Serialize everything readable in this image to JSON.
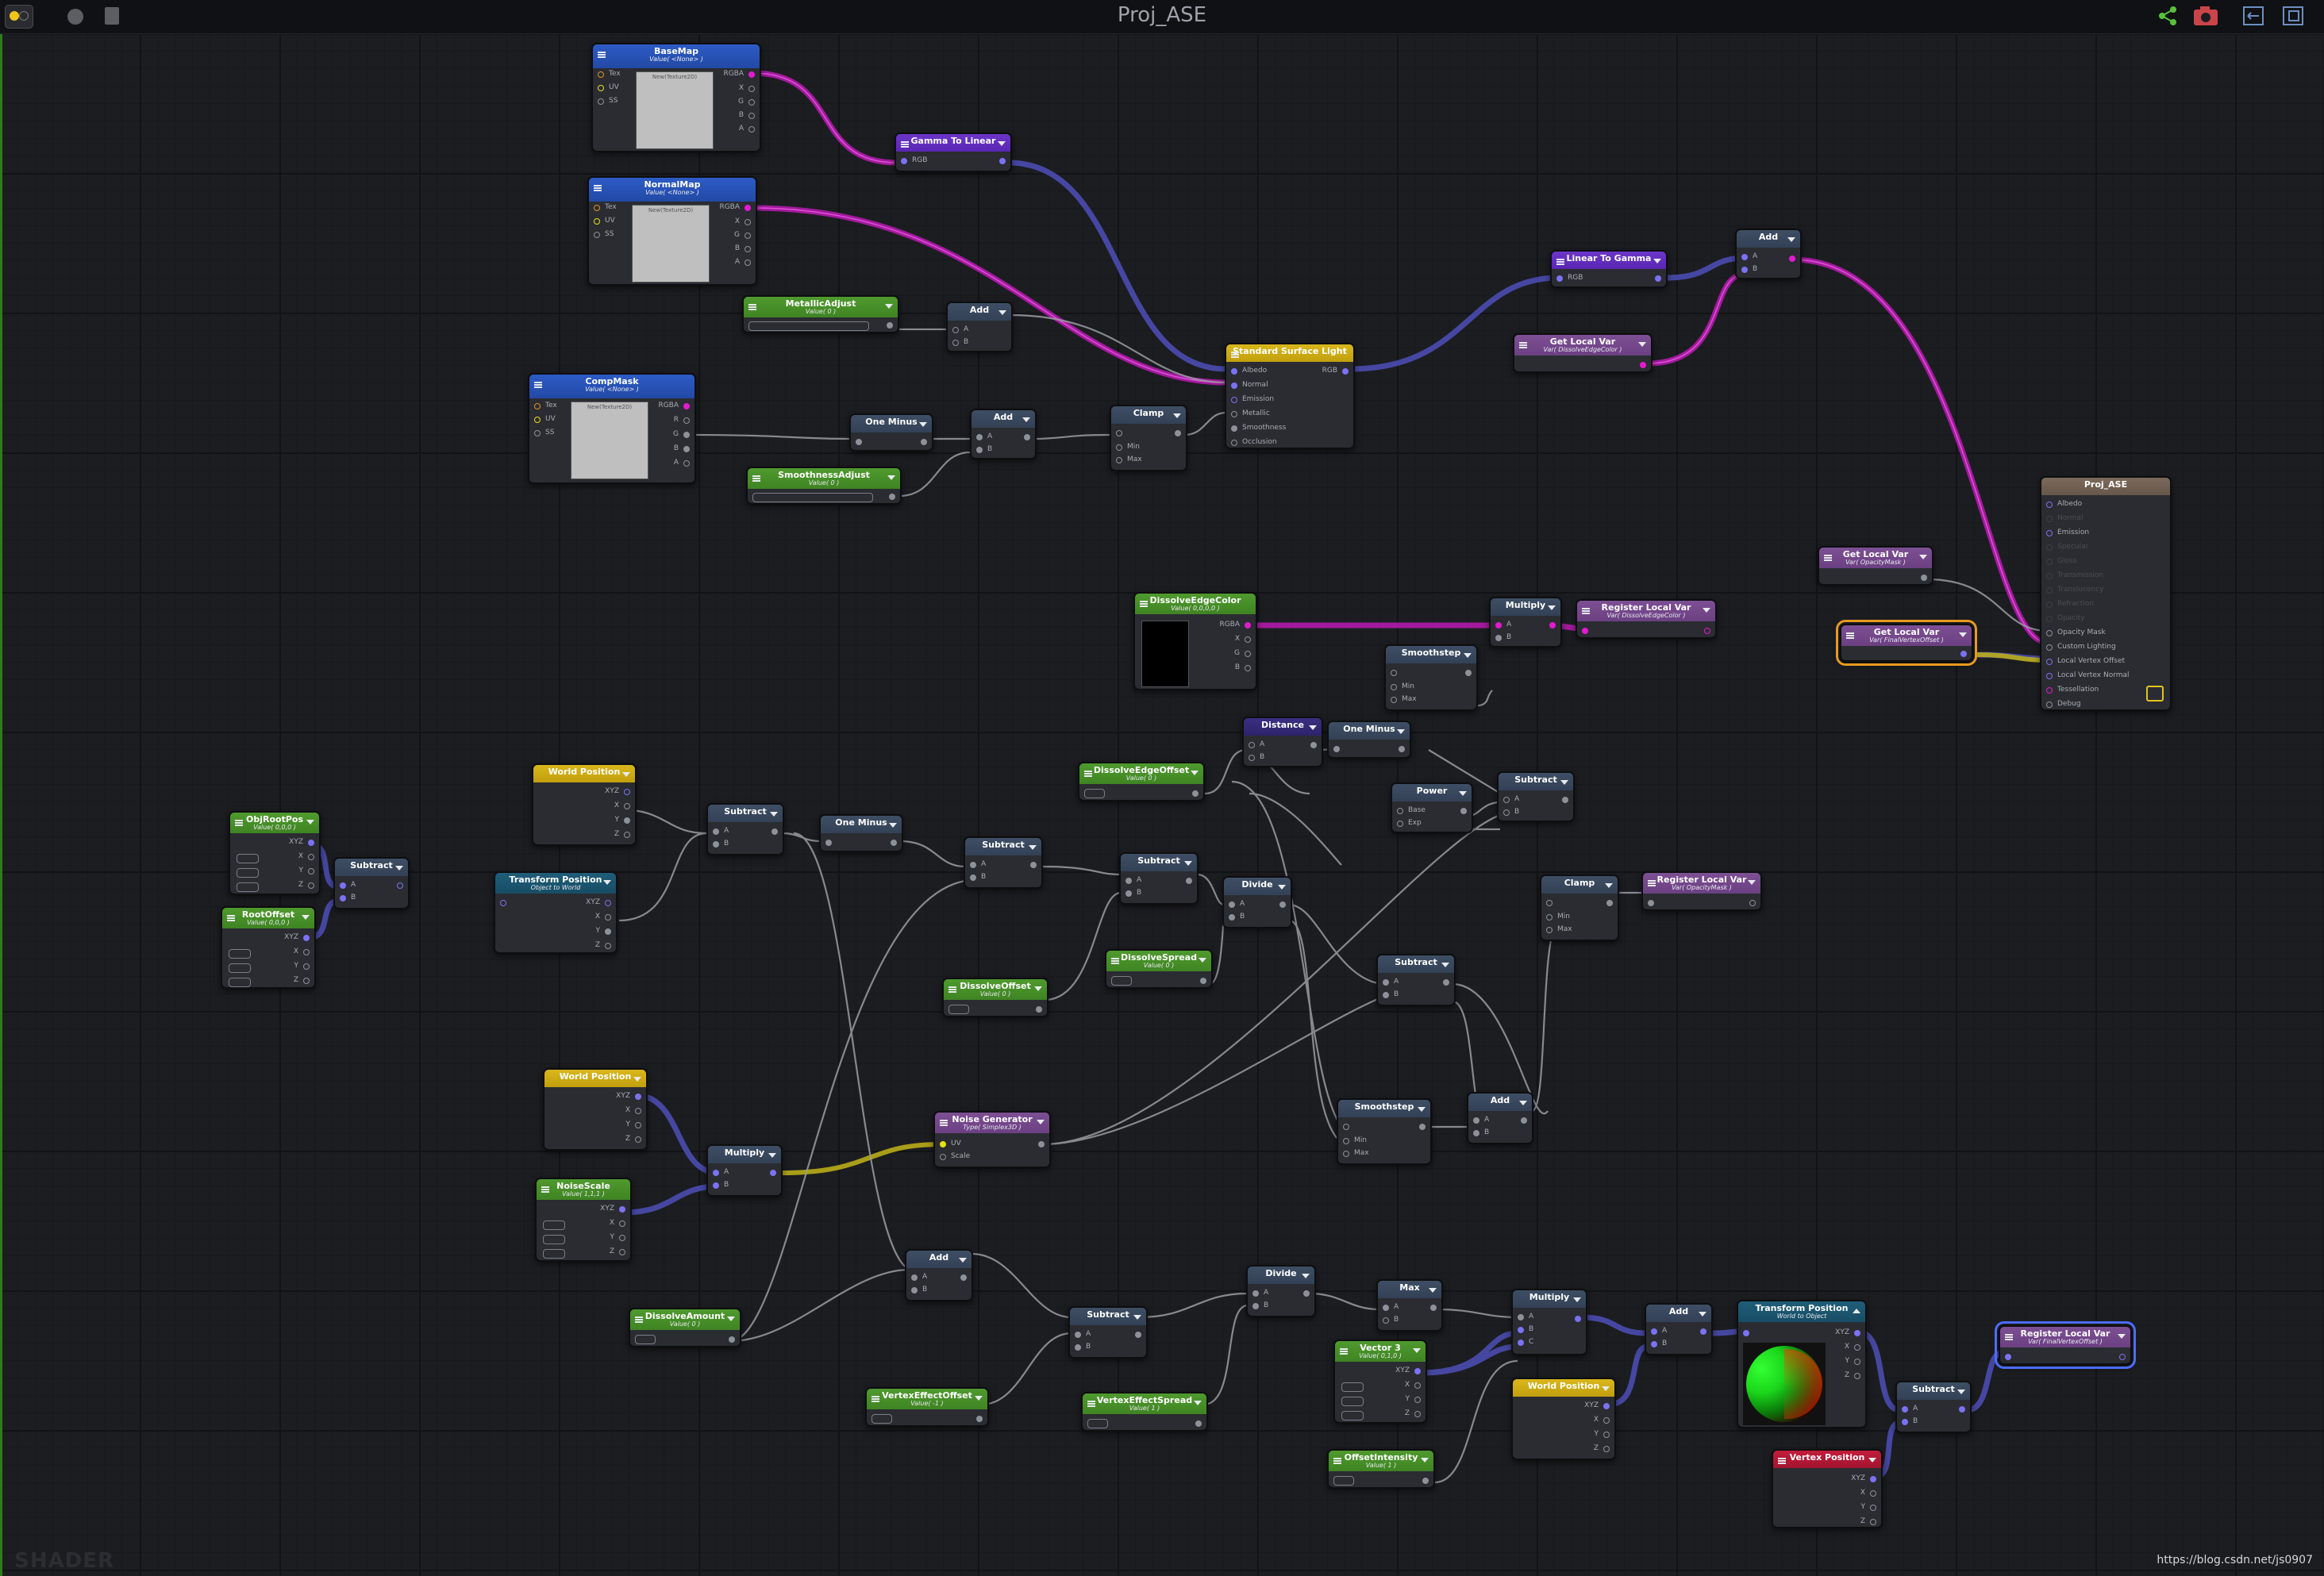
{
  "window": {
    "title": "Proj_ASE"
  },
  "footer": {
    "logo": "SHADER",
    "url": "https://blog.csdn.net/js0907"
  },
  "nodes": {
    "basemap": {
      "title": "BaseMap",
      "sub": "Value( <None> )",
      "preview": "New(Texture2D)"
    },
    "normalmap": {
      "title": "NormalMap",
      "sub": "Value( <None> )",
      "preview": "New(Texture2D)"
    },
    "compmask": {
      "title": "CompMask",
      "sub": "Value( <None> )",
      "preview": "New(Texture2D)"
    },
    "gamma_to_linear": {
      "title": "Gamma To Linear"
    },
    "metallic_adjust": {
      "title": "MetallicAdjust",
      "sub": "Value( 0 )"
    },
    "smoothness_adjust": {
      "title": "SmoothnessAdjust",
      "sub": "Value( 0 )"
    },
    "add_metal": {
      "title": "Add"
    },
    "one_minus_top": {
      "title": "One Minus"
    },
    "add_smooth": {
      "title": "Add"
    },
    "clamp_top": {
      "title": "Clamp"
    },
    "standard_surface": {
      "title": "Standard Surface Light"
    },
    "linear_to_gamma": {
      "title": "Linear To Gamma"
    },
    "add_top_right": {
      "title": "Add"
    },
    "get_local_var_edge": {
      "title": "Get Local Var",
      "sub": "Var( DissolveEdgeColor )"
    },
    "proj_ase": {
      "title": "Proj_ASE"
    },
    "get_local_var_opacity": {
      "title": "Get Local Var",
      "sub": "Var( OpacityMask )"
    },
    "get_local_var_offset": {
      "title": "Get Local Var",
      "sub": "Var( FinalVertexOffset )"
    },
    "dissolve_edge_color": {
      "title": "DissolveEdgeColor",
      "sub": "Value( 0,0,0,0 )"
    },
    "multiply_edge": {
      "title": "Multiply"
    },
    "register_edge": {
      "title": "Register Local Var",
      "sub": "Var( DissolveEdgeColor )"
    },
    "smoothstep_top": {
      "title": "Smoothstep"
    },
    "distance": {
      "title": "Distance"
    },
    "one_minus_mid": {
      "title": "One Minus"
    },
    "dissolve_edge_offset": {
      "title": "DissolveEdgeOffset",
      "sub": "Value( 0 )"
    },
    "power": {
      "title": "Power"
    },
    "subtract_power": {
      "title": "Subtract"
    },
    "clamp_mid": {
      "title": "Clamp"
    },
    "register_opacity": {
      "title": "Register Local Var",
      "sub": "Var( OpacityMask )"
    },
    "world_position_1": {
      "title": "World Position"
    },
    "objrootpos": {
      "title": "ObjRootPos",
      "sub": "Value( 0,0,0 )"
    },
    "subtract_root": {
      "title": "Subtract"
    },
    "rootoffset": {
      "title": "RootOffset",
      "sub": "Value( 0,0,0 )"
    },
    "transform_position_1": {
      "title": "Transform Position",
      "sub": "Object to World"
    },
    "subtract_1": {
      "title": "Subtract"
    },
    "one_minus_low": {
      "title": "One Minus"
    },
    "subtract_2": {
      "title": "Subtract"
    },
    "subtract_3": {
      "title": "Subtract"
    },
    "divide_mid": {
      "title": "Divide"
    },
    "dissolve_offset": {
      "title": "DissolveOffset",
      "sub": "Value( 0 )"
    },
    "dissolve_spread": {
      "title": "DissolveSpread",
      "sub": "Value( 0 )"
    },
    "subtract_4": {
      "title": "Subtract"
    },
    "world_position_2": {
      "title": "World Position"
    },
    "noise_scale": {
      "title": "NoiseScale",
      "sub": "Value( 1,1,1 )"
    },
    "multiply_noise": {
      "title": "Multiply"
    },
    "noise_generator": {
      "title": "Noise Generator",
      "sub": "Type( Simplex3D )"
    },
    "smoothstep_low": {
      "title": "Smoothstep"
    },
    "add_low": {
      "title": "Add"
    },
    "add_dissolve": {
      "title": "Add"
    },
    "dissolve_amount": {
      "title": "DissolveAmount",
      "sub": "Value( 0 )"
    },
    "subtract_vertex": {
      "title": "Subtract"
    },
    "divide_low": {
      "title": "Divide"
    },
    "max": {
      "title": "Max"
    },
    "vector3": {
      "title": "Vector 3",
      "sub": "Value( 0,1,0 )"
    },
    "multiply_low": {
      "title": "Multiply"
    },
    "add_final": {
      "title": "Add"
    },
    "transform_position_2": {
      "title": "Transform Position",
      "sub": "World to Object"
    },
    "world_position_3": {
      "title": "World Position"
    },
    "vertex_effect_offset": {
      "title": "VertexEffectOffset",
      "sub": "Value( -1 )"
    },
    "vertex_effect_spread": {
      "title": "VertexEffectSpread",
      "sub": "Value( 1 )"
    },
    "offset_intensity": {
      "title": "OffsetIntensity",
      "sub": "Value( 1 )"
    },
    "subtract_final": {
      "title": "Subtract"
    },
    "register_offset": {
      "title": "Register Local Var",
      "sub": "Var( FinalVertexOffset )"
    },
    "vertex_position": {
      "title": "Vertex Position"
    }
  },
  "labels": {
    "tex": "Tex",
    "uv": "UV",
    "ss": "SS",
    "rgba": "RGBA",
    "rgb": "RGB",
    "x": "X",
    "y": "Y",
    "z": "Z",
    "r": "R",
    "g": "G",
    "b": "B",
    "a": "A",
    "c": "C",
    "xyz": "XYZ",
    "min": "Min",
    "max": "Max",
    "base": "Base",
    "exp": "Exp",
    "scale": "Scale",
    "albedo": "Albedo",
    "normal": "Normal",
    "emission": "Emission",
    "metallic": "Metallic",
    "smoothness": "Smoothness",
    "occlusion": "Occlusion"
  },
  "master_ports": [
    "Albedo",
    "Normal",
    "Emission",
    "Specular",
    "Gloss",
    "Transmission",
    "Translucency",
    "Refraction",
    "Opacity",
    "Opacity Mask",
    "Custom Lighting",
    "Local Vertex Offset",
    "Local Vertex Normal",
    "Tessellation",
    "Debug"
  ],
  "master_ports_active": [
    0,
    2,
    9,
    10,
    11,
    12,
    13,
    14
  ],
  "colors": {
    "vector": "#7b72f2",
    "color": "#e21ad0",
    "float": "#8d9199",
    "uv": "#e8e010",
    "selection": "#e89a1e"
  },
  "icons": [
    "toggle-icon",
    "record-icon",
    "document-icon",
    "share-icon",
    "camera-icon",
    "fit-icon",
    "maximize-icon",
    "save-icon"
  ]
}
